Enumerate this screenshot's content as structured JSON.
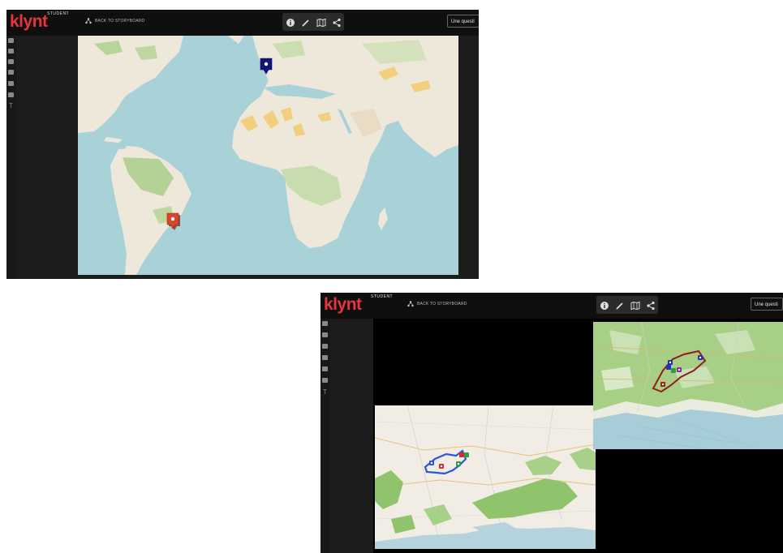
{
  "app": {
    "logo_text": "klynt",
    "logo_badge": "STUDENT",
    "back_link": "BACK TO STORYBOARD",
    "question_placeholder": "Une questi",
    "brand_color": "#e8353d"
  },
  "toolbar": {
    "icons": [
      "info-icon",
      "pencil-icon",
      "map-icon",
      "share-icon"
    ]
  },
  "sidebar": {
    "icons": [
      "grid-icon",
      "camera-icon",
      "video-icon",
      "music-icon",
      "image-icon",
      "slideshow-icon"
    ],
    "text_tool": "T"
  },
  "screens": [
    {
      "name": "world-map-view",
      "markers": [
        {
          "name": "europe-marker",
          "color": "#13137a"
        },
        {
          "name": "brazil-marker",
          "color": "#d9462b"
        }
      ]
    },
    {
      "name": "split-map-view",
      "markers": [
        {
          "name": "rio-marker-blue",
          "color": "#2e55d8"
        },
        {
          "name": "rio-marker-red",
          "color": "#d02e2e"
        },
        {
          "name": "rio-marker-green",
          "color": "#2e9d3a"
        },
        {
          "name": "alps-marker-blue",
          "color": "#2231b5"
        },
        {
          "name": "alps-marker-purple",
          "color": "#8e2aa6"
        },
        {
          "name": "alps-marker-red",
          "color": "#a01d1d"
        }
      ]
    }
  ]
}
